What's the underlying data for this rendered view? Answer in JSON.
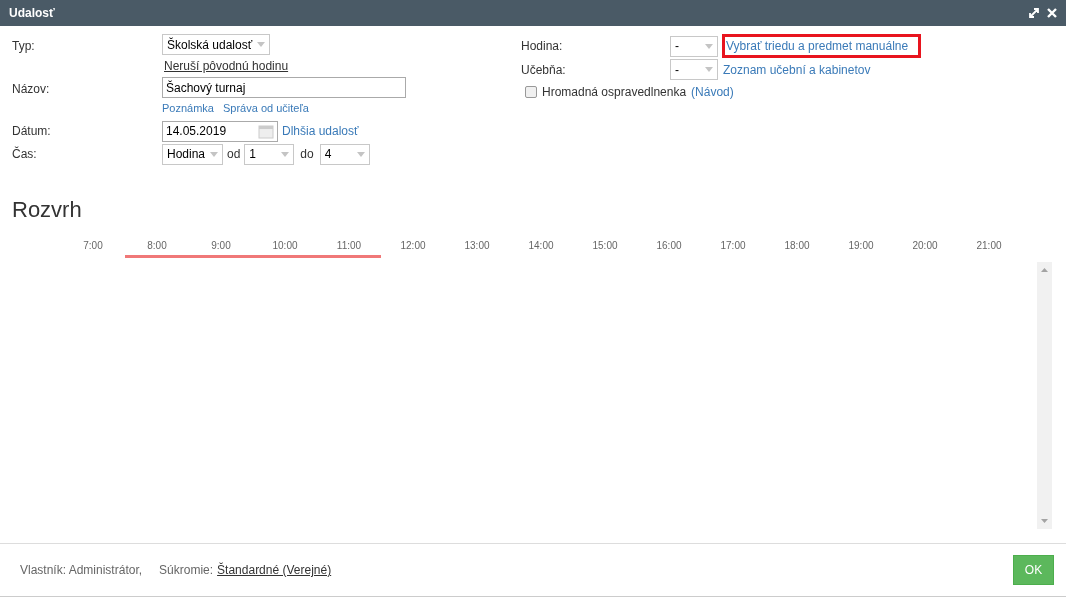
{
  "window": {
    "title": "Udalosť"
  },
  "form": {
    "type": {
      "label": "Typ:",
      "value": "Školská udalosť",
      "link": "Neruší pôvodnú hodinu"
    },
    "name": {
      "label": "Názov:",
      "value": "Šachový turnaj",
      "links": [
        "Poznámka",
        "Správa od učiteľa"
      ]
    },
    "date": {
      "label": "Dátum:",
      "value": "14.05.2019",
      "link": "Dlhšia udalosť"
    },
    "time": {
      "label": "Čas:",
      "unit": "Hodina",
      "from_label": "od",
      "from": "1",
      "to_label": "do",
      "to": "4"
    },
    "lesson": {
      "label": "Hodina:",
      "value": "-",
      "link": "Vybrať triedu a predmet manuálne",
      "highlighted": true
    },
    "room": {
      "label": "Učebňa:",
      "value": "-",
      "link": "Zoznam učební a kabinetov"
    },
    "bulk_excuse": {
      "label": "Hromadná ospravedlnenka",
      "checked": false,
      "link": "(Návod)"
    }
  },
  "schedule": {
    "title": "Rozvrh",
    "hours": [
      {
        "label": "7:00",
        "in_event": false
      },
      {
        "label": "8:00",
        "in_event": true
      },
      {
        "label": "9:00",
        "in_event": true
      },
      {
        "label": "10:00",
        "in_event": true
      },
      {
        "label": "11:00",
        "in_event": true
      },
      {
        "label": "12:00",
        "in_event": false
      },
      {
        "label": "13:00",
        "in_event": false
      },
      {
        "label": "14:00",
        "in_event": false
      },
      {
        "label": "15:00",
        "in_event": false
      },
      {
        "label": "16:00",
        "in_event": false
      },
      {
        "label": "17:00",
        "in_event": false
      },
      {
        "label": "18:00",
        "in_event": false
      },
      {
        "label": "19:00",
        "in_event": false
      },
      {
        "label": "20:00",
        "in_event": false
      },
      {
        "label": "21:00",
        "in_event": false
      }
    ]
  },
  "footer": {
    "owner": "Vlastník: Administrátor,",
    "privacy_label": "Súkromie:",
    "privacy": "Štandardné (Verejné)",
    "ok": "OK"
  }
}
